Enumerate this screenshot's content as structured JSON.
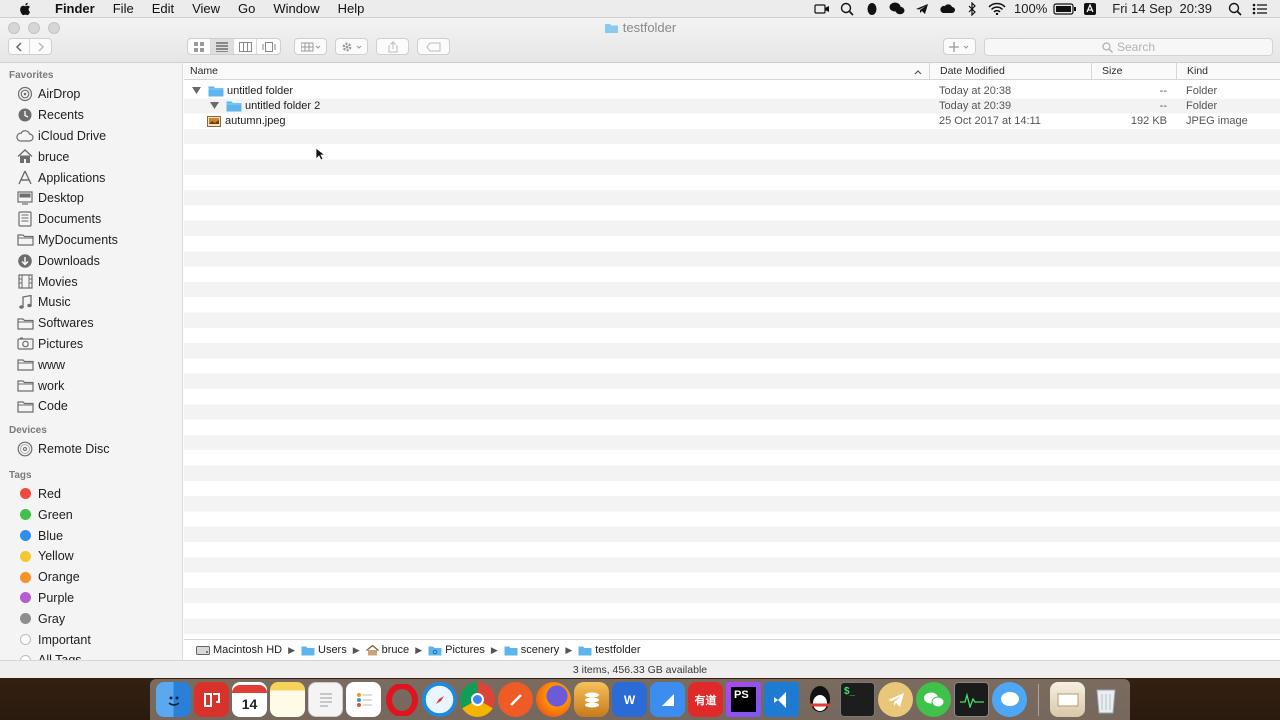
{
  "menubar": {
    "app_name": "Finder",
    "menus": [
      "File",
      "Edit",
      "View",
      "Go",
      "Window",
      "Help"
    ],
    "battery": "100%",
    "datetime": "Fri 14 Sep  20:39"
  },
  "window": {
    "title": "testfolder"
  },
  "toolbar": {
    "search_placeholder": "Search"
  },
  "sidebar": {
    "favorites_header": "Favorites",
    "favorites": [
      {
        "label": "AirDrop",
        "icon": "airdrop-icon"
      },
      {
        "label": "Recents",
        "icon": "recents-icon"
      },
      {
        "label": "iCloud Drive",
        "icon": "cloud-icon"
      },
      {
        "label": "bruce",
        "icon": "home-icon"
      },
      {
        "label": "Applications",
        "icon": "applications-icon"
      },
      {
        "label": "Desktop",
        "icon": "desktop-icon"
      },
      {
        "label": "Documents",
        "icon": "documents-icon"
      },
      {
        "label": "MyDocuments",
        "icon": "folder-icon"
      },
      {
        "label": "Downloads",
        "icon": "downloads-icon"
      },
      {
        "label": "Movies",
        "icon": "movies-icon"
      },
      {
        "label": "Music",
        "icon": "music-icon"
      },
      {
        "label": "Softwares",
        "icon": "folder-icon"
      },
      {
        "label": "Pictures",
        "icon": "pictures-icon"
      },
      {
        "label": "www",
        "icon": "folder-icon"
      },
      {
        "label": "work",
        "icon": "folder-icon"
      },
      {
        "label": "Code",
        "icon": "folder-icon"
      }
    ],
    "devices_header": "Devices",
    "devices": [
      {
        "label": "Remote Disc",
        "icon": "disc-icon"
      }
    ],
    "tags_header": "Tags",
    "tags": [
      {
        "label": "Red",
        "color": "#f04a3e"
      },
      {
        "label": "Green",
        "color": "#3fc14a"
      },
      {
        "label": "Blue",
        "color": "#2f8ef0"
      },
      {
        "label": "Yellow",
        "color": "#f6c631"
      },
      {
        "label": "Orange",
        "color": "#f79128"
      },
      {
        "label": "Purple",
        "color": "#b65ad1"
      },
      {
        "label": "Gray",
        "color": "#8e8e8e"
      },
      {
        "label": "Important",
        "color": "#e0e0e0"
      },
      {
        "label": "All Tags…",
        "color": ""
      }
    ]
  },
  "columns": {
    "name": "Name",
    "date": "Date Modified",
    "size": "Size",
    "kind": "Kind"
  },
  "files": [
    {
      "name": "untitled folder",
      "date": "Today at 20:38",
      "size": "--",
      "kind": "Folder"
    },
    {
      "name": "untitled folder 2",
      "date": "Today at 20:39",
      "size": "--",
      "kind": "Folder"
    },
    {
      "name": "autumn.jpeg",
      "date": "25 Oct 2017 at 14:11",
      "size": "192 KB",
      "kind": "JPEG image"
    }
  ],
  "path": [
    "Macintosh HD",
    "Users",
    "bruce",
    "Pictures",
    "scenery",
    "testfolder"
  ],
  "status": "3 items, 456.33 GB available",
  "colors": {
    "folder_blue": "#5fb4ee",
    "accent": "#2f8ef0"
  }
}
